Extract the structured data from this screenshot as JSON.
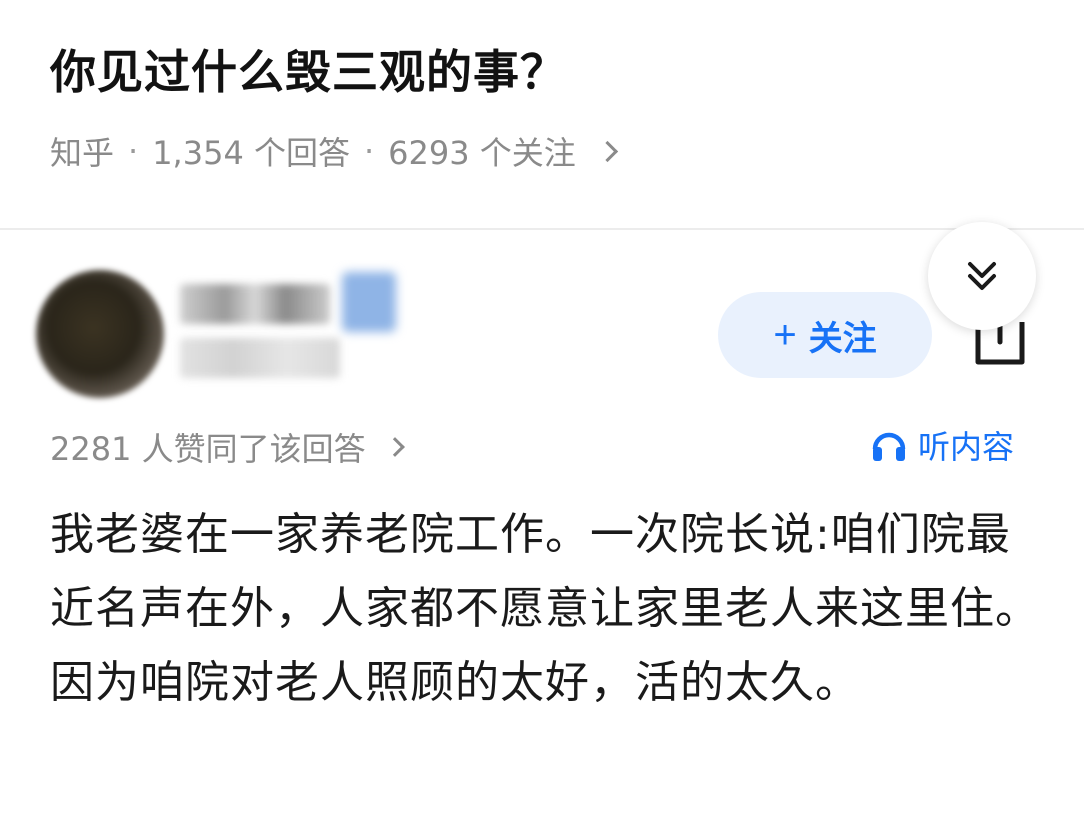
{
  "question": {
    "title": "你见过什么毁三观的事？",
    "meta_source": "知乎",
    "meta_answers": "1,354 个回答",
    "meta_followers": "6293 个关注"
  },
  "author": {
    "follow_label": "关注"
  },
  "answer": {
    "upvotes": "2281 人赞同了该回答",
    "listen_label": "听内容",
    "body": "我老婆在一家养老院工作。一次院长说:咱们院最近名声在外，人家都不愿意让家里老人来这里住。因为咱院对老人照顾的太好，活的太久。"
  },
  "colors": {
    "accent": "#1772f6",
    "accent_bg": "#e9f1fd",
    "meta_gray": "#8a8a8a",
    "title": "#121212"
  },
  "icons": {
    "collapse": "double-chevron-down-icon",
    "share": "share-icon",
    "listen": "headphones-icon",
    "follow": "plus-icon"
  }
}
